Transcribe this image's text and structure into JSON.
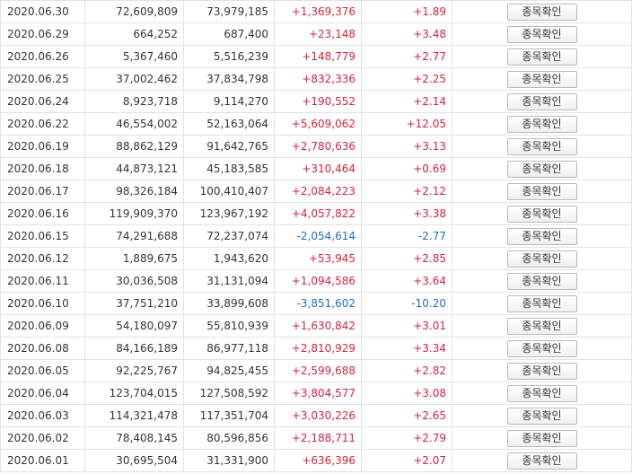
{
  "action_label": "종목확인",
  "colors": {
    "up": "#d6233c",
    "down": "#1f6dc2",
    "border": "#e2e2e2"
  },
  "rows": [
    {
      "date": "2020.06.30",
      "v1": "72,609,809",
      "v2": "73,979,185",
      "chg": "+1,369,376",
      "pct": "+1.89",
      "dir": "up"
    },
    {
      "date": "2020.06.29",
      "v1": "664,252",
      "v2": "687,400",
      "chg": "+23,148",
      "pct": "+3.48",
      "dir": "up"
    },
    {
      "date": "2020.06.26",
      "v1": "5,367,460",
      "v2": "5,516,239",
      "chg": "+148,779",
      "pct": "+2.77",
      "dir": "up"
    },
    {
      "date": "2020.06.25",
      "v1": "37,002,462",
      "v2": "37,834,798",
      "chg": "+832,336",
      "pct": "+2.25",
      "dir": "up"
    },
    {
      "date": "2020.06.24",
      "v1": "8,923,718",
      "v2": "9,114,270",
      "chg": "+190,552",
      "pct": "+2.14",
      "dir": "up"
    },
    {
      "date": "2020.06.22",
      "v1": "46,554,002",
      "v2": "52,163,064",
      "chg": "+5,609,062",
      "pct": "+12.05",
      "dir": "up"
    },
    {
      "date": "2020.06.19",
      "v1": "88,862,129",
      "v2": "91,642,765",
      "chg": "+2,780,636",
      "pct": "+3.13",
      "dir": "up"
    },
    {
      "date": "2020.06.18",
      "v1": "44,873,121",
      "v2": "45,183,585",
      "chg": "+310,464",
      "pct": "+0.69",
      "dir": "up"
    },
    {
      "date": "2020.06.17",
      "v1": "98,326,184",
      "v2": "100,410,407",
      "chg": "+2,084,223",
      "pct": "+2.12",
      "dir": "up"
    },
    {
      "date": "2020.06.16",
      "v1": "119,909,370",
      "v2": "123,967,192",
      "chg": "+4,057,822",
      "pct": "+3.38",
      "dir": "up"
    },
    {
      "date": "2020.06.15",
      "v1": "74,291,688",
      "v2": "72,237,074",
      "chg": "-2,054,614",
      "pct": "-2.77",
      "dir": "down"
    },
    {
      "date": "2020.06.12",
      "v1": "1,889,675",
      "v2": "1,943,620",
      "chg": "+53,945",
      "pct": "+2.85",
      "dir": "up"
    },
    {
      "date": "2020.06.11",
      "v1": "30,036,508",
      "v2": "31,131,094",
      "chg": "+1,094,586",
      "pct": "+3.64",
      "dir": "up"
    },
    {
      "date": "2020.06.10",
      "v1": "37,751,210",
      "v2": "33,899,608",
      "chg": "-3,851,602",
      "pct": "-10.20",
      "dir": "down"
    },
    {
      "date": "2020.06.09",
      "v1": "54,180,097",
      "v2": "55,810,939",
      "chg": "+1,630,842",
      "pct": "+3.01",
      "dir": "up"
    },
    {
      "date": "2020.06.08",
      "v1": "84,166,189",
      "v2": "86,977,118",
      "chg": "+2,810,929",
      "pct": "+3.34",
      "dir": "up"
    },
    {
      "date": "2020.06.05",
      "v1": "92,225,767",
      "v2": "94,825,455",
      "chg": "+2,599,688",
      "pct": "+2.82",
      "dir": "up"
    },
    {
      "date": "2020.06.04",
      "v1": "123,704,015",
      "v2": "127,508,592",
      "chg": "+3,804,577",
      "pct": "+3.08",
      "dir": "up"
    },
    {
      "date": "2020.06.03",
      "v1": "114,321,478",
      "v2": "117,351,704",
      "chg": "+3,030,226",
      "pct": "+2.65",
      "dir": "up"
    },
    {
      "date": "2020.06.02",
      "v1": "78,408,145",
      "v2": "80,596,856",
      "chg": "+2,188,711",
      "pct": "+2.79",
      "dir": "up"
    },
    {
      "date": "2020.06.01",
      "v1": "30,695,504",
      "v2": "31,331,900",
      "chg": "+636,396",
      "pct": "+2.07",
      "dir": "up"
    }
  ]
}
